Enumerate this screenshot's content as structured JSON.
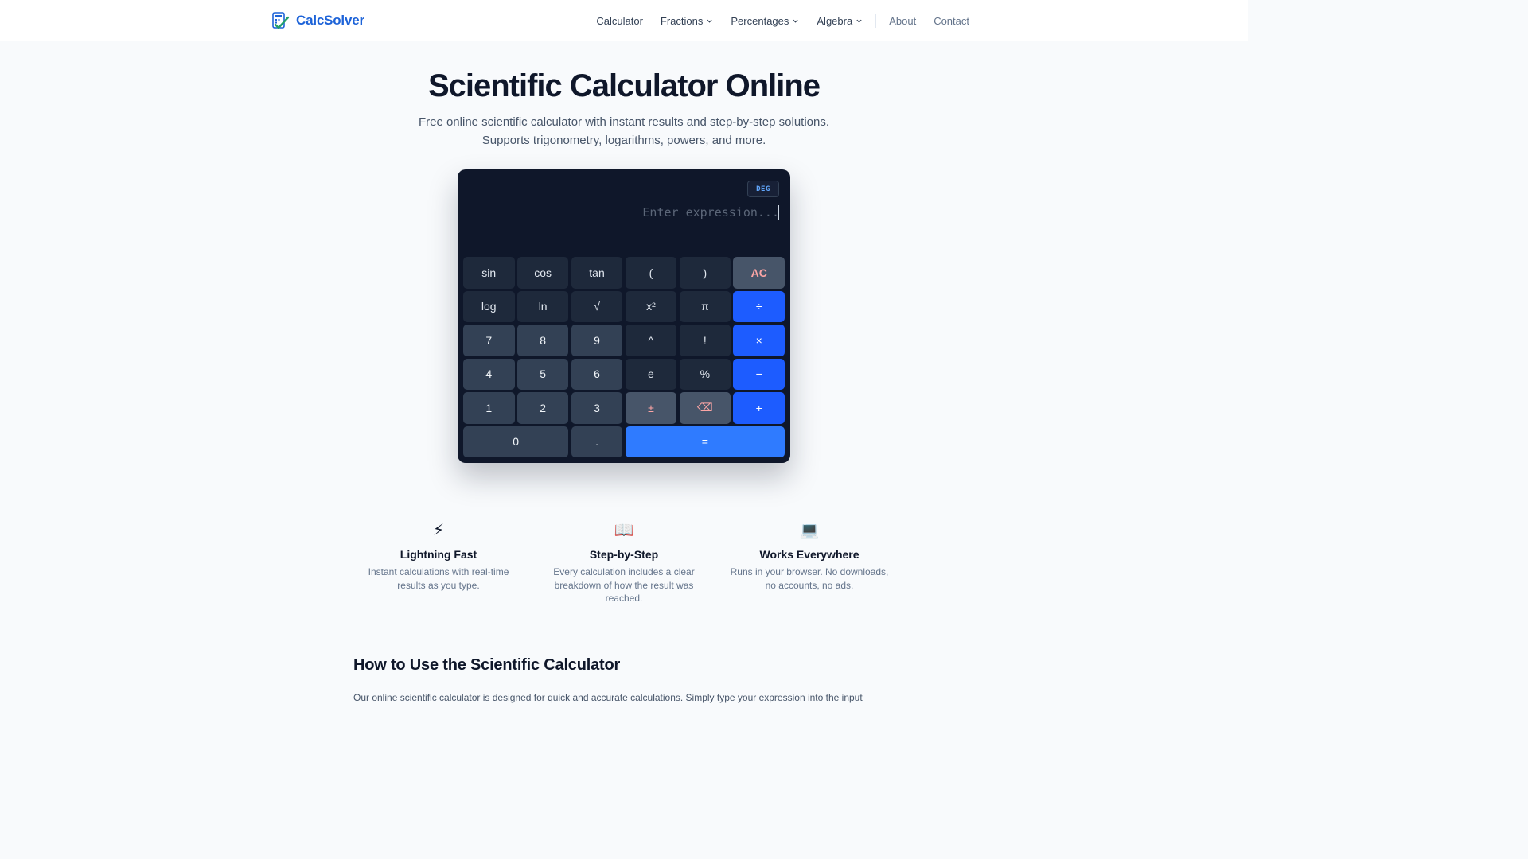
{
  "header": {
    "brand": "CalcSolver",
    "nav": [
      {
        "label": "Calculator",
        "dropdown": false
      },
      {
        "label": "Fractions",
        "dropdown": true
      },
      {
        "label": "Percentages",
        "dropdown": true
      },
      {
        "label": "Algebra",
        "dropdown": true
      },
      {
        "label": "About",
        "dropdown": false
      },
      {
        "label": "Contact",
        "dropdown": false
      }
    ]
  },
  "hero": {
    "title": "Scientific Calculator Online",
    "subtitle_line1": "Free online scientific calculator with instant results and step-by-step solutions.",
    "subtitle_line2": "Supports trigonometry, logarithms, powers, and more."
  },
  "calculator": {
    "mode": "DEG",
    "expression_value": "",
    "expression_placeholder": "Enter expression...",
    "keys": [
      [
        "sin",
        "cos",
        "tan",
        "(",
        ")",
        "AC"
      ],
      [
        "log",
        "ln",
        "√",
        "x²",
        "π",
        "÷"
      ],
      [
        "7",
        "8",
        "9",
        "^",
        "!",
        "×"
      ],
      [
        "4",
        "5",
        "6",
        "e",
        "%",
        "−"
      ],
      [
        "1",
        "2",
        "3",
        "±",
        "⌫",
        "+"
      ],
      [
        "0",
        ".",
        "="
      ]
    ]
  },
  "features": [
    {
      "icon": "lightning-icon",
      "glyph": "⚡",
      "title": "Lightning Fast",
      "desc": "Instant calculations with real-time results as you type."
    },
    {
      "icon": "book-icon",
      "glyph": "📖",
      "title": "Step-by-Step",
      "desc": "Every calculation includes a clear breakdown of how the result was reached."
    },
    {
      "icon": "laptop-icon",
      "glyph": "💻",
      "title": "Works Everywhere",
      "desc": "Runs in your browser. No downloads, no accounts, no ads."
    }
  ],
  "section": {
    "title": "How to Use the Scientific Calculator",
    "body": "Our online scientific calculator is designed for quick and accurate calculations. Simply type your expression into the input"
  },
  "colors": {
    "brand": "#1d63d8",
    "calc_bg": "#0f172a",
    "operator": "#1d5cff",
    "equals": "#2f7bff",
    "clear_text": "#fca5a5"
  }
}
